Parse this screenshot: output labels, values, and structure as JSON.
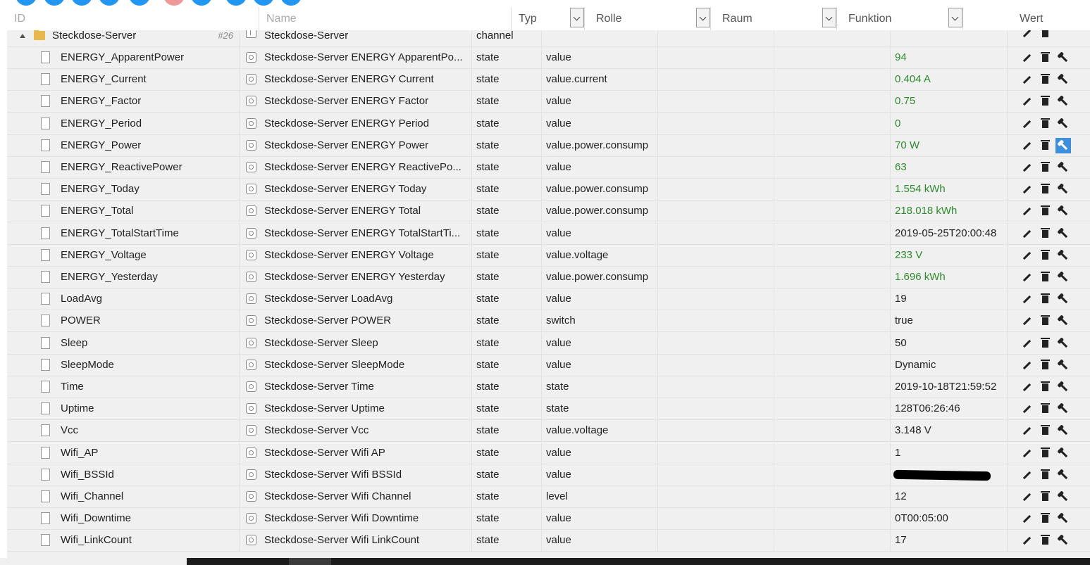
{
  "header": {
    "id_label": "ID",
    "name_label": "Name",
    "typ_label": "Typ",
    "rolle_label": "Rolle",
    "raum_label": "Raum",
    "funktion_label": "Funktion",
    "wert_label": "Wert"
  },
  "channel": {
    "id": "Steckdose-Server",
    "badge": "#26",
    "name": "Steckdose-Server",
    "typ": "channel"
  },
  "rows": [
    {
      "id": "ENERGY_ApparentPower",
      "name": "Steckdose-Server ENERGY ApparentPo...",
      "typ": "state",
      "rolle": "value",
      "wert": "94",
      "color": "#2e8b2e"
    },
    {
      "id": "ENERGY_Current",
      "name": "Steckdose-Server ENERGY Current",
      "typ": "state",
      "rolle": "value.current",
      "wert": "0.404 A",
      "color": "#2e8b2e"
    },
    {
      "id": "ENERGY_Factor",
      "name": "Steckdose-Server ENERGY Factor",
      "typ": "state",
      "rolle": "value",
      "wert": "0.75",
      "color": "#2e8b2e"
    },
    {
      "id": "ENERGY_Period",
      "name": "Steckdose-Server ENERGY Period",
      "typ": "state",
      "rolle": "value",
      "wert": "0",
      "color": "#2e8b2e"
    },
    {
      "id": "ENERGY_Power",
      "name": "Steckdose-Server ENERGY Power",
      "typ": "state",
      "rolle": "value.power.consump",
      "wert": "70 W",
      "color": "#2e8b2e",
      "selected_wrench": true
    },
    {
      "id": "ENERGY_ReactivePower",
      "name": "Steckdose-Server ENERGY ReactivePo...",
      "typ": "state",
      "rolle": "value",
      "wert": "63",
      "color": "#2e8b2e"
    },
    {
      "id": "ENERGY_Today",
      "name": "Steckdose-Server ENERGY Today",
      "typ": "state",
      "rolle": "value.power.consump",
      "wert": "1.554 kWh",
      "color": "#2e8b2e"
    },
    {
      "id": "ENERGY_Total",
      "name": "Steckdose-Server ENERGY Total",
      "typ": "state",
      "rolle": "value.power.consump",
      "wert": "218.018 kWh",
      "color": "#2e8b2e"
    },
    {
      "id": "ENERGY_TotalStartTime",
      "name": "Steckdose-Server ENERGY TotalStartTi...",
      "typ": "state",
      "rolle": "value",
      "wert": "2019-05-25T20:00:48",
      "color": "#222222"
    },
    {
      "id": "ENERGY_Voltage",
      "name": "Steckdose-Server ENERGY Voltage",
      "typ": "state",
      "rolle": "value.voltage",
      "wert": "233 V",
      "color": "#2e8b2e"
    },
    {
      "id": "ENERGY_Yesterday",
      "name": "Steckdose-Server ENERGY Yesterday",
      "typ": "state",
      "rolle": "value.power.consump",
      "wert": "1.696 kWh",
      "color": "#2e8b2e"
    },
    {
      "id": "LoadAvg",
      "name": "Steckdose-Server LoadAvg",
      "typ": "state",
      "rolle": "value",
      "wert": "19",
      "color": "#222222"
    },
    {
      "id": "POWER",
      "name": "Steckdose-Server POWER",
      "typ": "state",
      "rolle": "switch",
      "wert": "true",
      "color": "#222222"
    },
    {
      "id": "Sleep",
      "name": "Steckdose-Server Sleep",
      "typ": "state",
      "rolle": "value",
      "wert": "50",
      "color": "#222222"
    },
    {
      "id": "SleepMode",
      "name": "Steckdose-Server SleepMode",
      "typ": "state",
      "rolle": "value",
      "wert": "Dynamic",
      "color": "#222222"
    },
    {
      "id": "Time",
      "name": "Steckdose-Server Time",
      "typ": "state",
      "rolle": "state",
      "wert": "2019-10-18T21:59:52",
      "color": "#222222"
    },
    {
      "id": "Uptime",
      "name": "Steckdose-Server Uptime",
      "typ": "state",
      "rolle": "state",
      "wert": "128T06:26:46",
      "color": "#222222"
    },
    {
      "id": "Vcc",
      "name": "Steckdose-Server Vcc",
      "typ": "state",
      "rolle": "value.voltage",
      "wert": "3.148 V",
      "color": "#222222"
    },
    {
      "id": "Wifi_AP",
      "name": "Steckdose-Server Wifi AP",
      "typ": "state",
      "rolle": "value",
      "wert": "1",
      "color": "#222222"
    },
    {
      "id": "Wifi_BSSId",
      "name": "Steckdose-Server Wifi BSSId",
      "typ": "state",
      "rolle": "value",
      "wert": "",
      "color": "#222222",
      "redacted": true
    },
    {
      "id": "Wifi_Channel",
      "name": "Steckdose-Server Wifi Channel",
      "typ": "state",
      "rolle": "level",
      "wert": "12",
      "color": "#222222"
    },
    {
      "id": "Wifi_Downtime",
      "name": "Steckdose-Server Wifi Downtime",
      "typ": "state",
      "rolle": "value",
      "wert": "0T00:05:00",
      "color": "#222222"
    },
    {
      "id": "Wifi_LinkCount",
      "name": "Steckdose-Server Wifi LinkCount",
      "typ": "state",
      "rolle": "value",
      "wert": "17",
      "color": "#222222"
    }
  ],
  "icons": {
    "edit": "pencil-icon",
    "delete": "trash-icon",
    "settings": "wrench-icon"
  },
  "colors": {
    "accent": "#2196f3",
    "value_green": "#2e8b2e",
    "selected": "#3d8fdb"
  }
}
